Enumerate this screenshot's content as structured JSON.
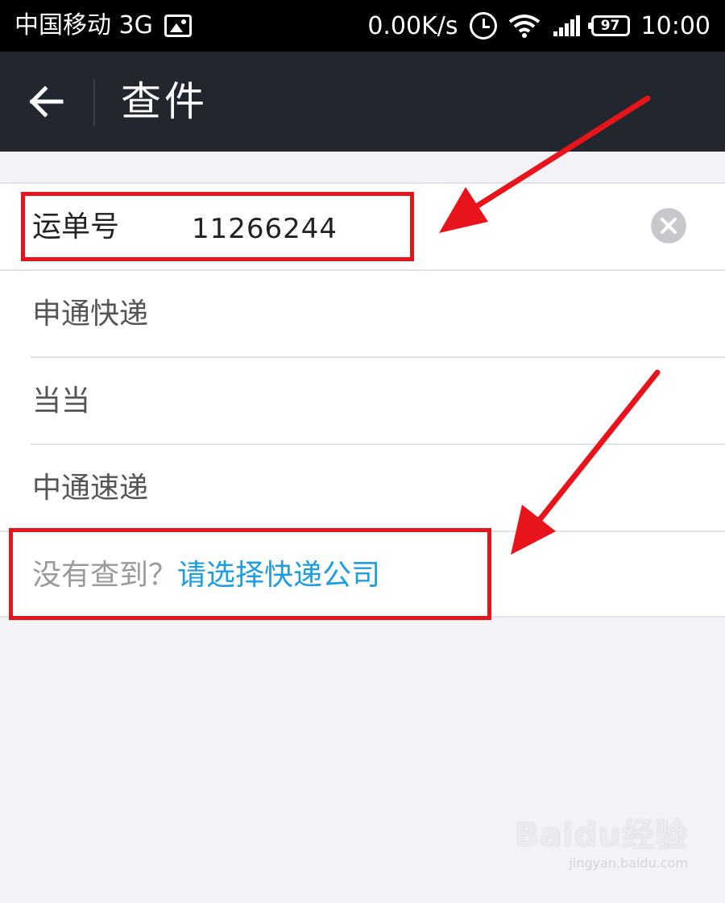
{
  "status_bar": {
    "carrier": "中国移动 3G",
    "speed": "0.00K/s",
    "battery": "97",
    "time": "10:00"
  },
  "header": {
    "title": "查件"
  },
  "waybill": {
    "label": "运单号",
    "value": "11266244"
  },
  "suggestions": [
    {
      "label": "申通快递"
    },
    {
      "label": "当当"
    },
    {
      "label": "中通速递"
    }
  ],
  "not_found": {
    "question": "没有查到？",
    "link": "请选择快递公司"
  },
  "colors": {
    "header_bg": "#22262f",
    "link": "#1c9ee0",
    "annotation": "#e8141b"
  },
  "watermark": {
    "logo": "Baidu经验",
    "url": "jingyan.baidu.com"
  }
}
